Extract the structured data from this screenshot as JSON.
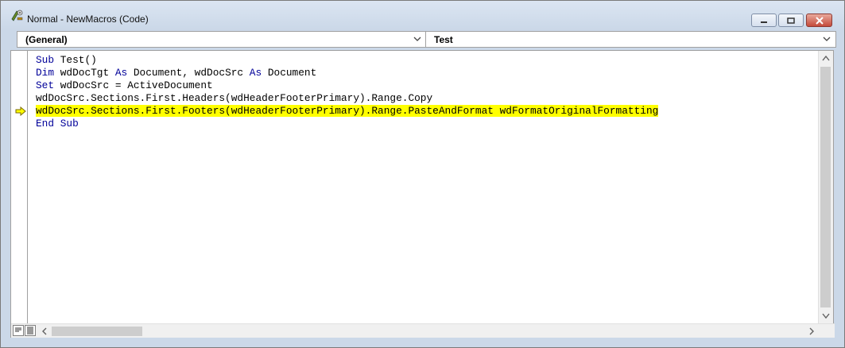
{
  "window": {
    "title": "Normal - NewMacros (Code)"
  },
  "dropdowns": {
    "object": "(General)",
    "procedure": "Test"
  },
  "code": {
    "lines": [
      [
        {
          "t": "Sub",
          "kw": true
        },
        {
          "t": " Test()"
        }
      ],
      [
        {
          "t": "Dim",
          "kw": true
        },
        {
          "t": " wdDocTgt "
        },
        {
          "t": "As",
          "kw": true
        },
        {
          "t": " Document, wdDocSrc "
        },
        {
          "t": "As",
          "kw": true
        },
        {
          "t": " Document"
        }
      ],
      [
        {
          "t": "Set",
          "kw": true
        },
        {
          "t": " wdDocSrc = ActiveDocument"
        }
      ],
      [
        {
          "t": "wdDocSrc.Sections.First.Headers(wdHeaderFooterPrimary).Range.Copy"
        }
      ],
      [
        {
          "t": "wdDocSrc.Sections.First.Footers(wdHeaderFooterPrimary).Range.PasteAndFormat wdFormatOriginalFormatting"
        }
      ],
      [
        {
          "t": "End Sub",
          "kw": true
        }
      ]
    ],
    "highlighted_line": 4
  },
  "colors": {
    "keyword": "#000099",
    "highlight": "#ffff00"
  },
  "icons": {
    "app": "vba-macro-icon",
    "execution": "execution-point-arrow-icon"
  }
}
